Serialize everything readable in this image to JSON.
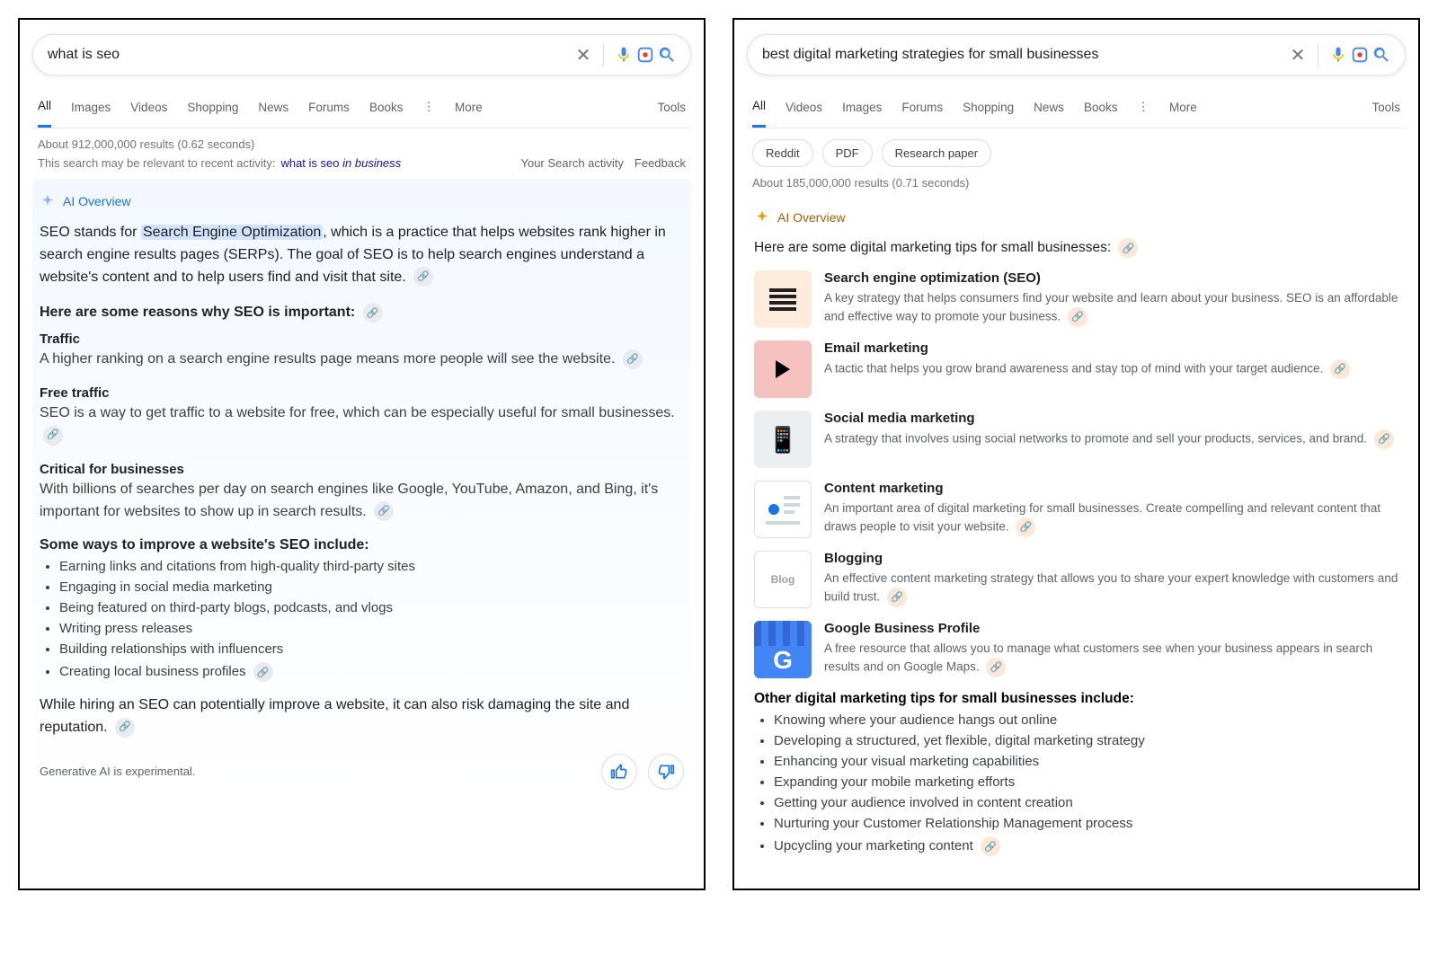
{
  "left": {
    "search": {
      "query": "what is seo"
    },
    "tabs": [
      "All",
      "Images",
      "Videos",
      "Shopping",
      "News",
      "Forums",
      "Books"
    ],
    "more": "More",
    "tools": "Tools",
    "results_meta": "About 912,000,000 results (0.62 seconds)",
    "activity": {
      "prefix": "This search may be relevant to recent activity:",
      "link_plain": "what is seo",
      "link_em": "in business",
      "search_activity": "Your Search activity",
      "feedback": "Feedback"
    },
    "ai_label": "AI Overview",
    "summary_pre": "SEO stands for ",
    "summary_hl": "Search Engine Optimization",
    "summary_post": ", which is a practice that helps websites rank higher in search engine results pages (SERPs). The goal of SEO is to help search engines understand a website's content and to help users find and visit that site.",
    "reasons_h": "Here are some reasons why SEO is important:",
    "reasons": [
      {
        "h": "Traffic",
        "p": "A higher ranking on a search engine results page means more people will see the website."
      },
      {
        "h": "Free traffic",
        "p": "SEO is a way to get traffic to a website for free, which can be especially useful for small businesses."
      },
      {
        "h": "Critical for businesses",
        "p": "With billions of searches per day on search engines like Google, YouTube, Amazon, and Bing, it's important for websites to show up in search results."
      }
    ],
    "ways_h": "Some ways to improve a website's SEO include:",
    "ways": [
      "Earning links and citations from high-quality third-party sites",
      "Engaging in social media marketing",
      "Being featured on third-party blogs, podcasts, and vlogs",
      "Writing press releases",
      "Building relationships with influencers",
      "Creating local business profiles"
    ],
    "closing": "While hiring an SEO can potentially improve a website, it can also risk damaging the site and reputation.",
    "experimental": "Generative AI is experimental."
  },
  "right": {
    "search": {
      "query": "best digital marketing strategies for small businesses"
    },
    "tabs": [
      "All",
      "Videos",
      "Images",
      "Forums",
      "Shopping",
      "News",
      "Books"
    ],
    "more": "More",
    "tools": "Tools",
    "chips": [
      "Reddit",
      "PDF",
      "Research paper"
    ],
    "results_meta": "About 185,000,000 results (0.71 seconds)",
    "ai_label": "AI Overview",
    "intro": "Here are some digital marketing tips for small businesses:",
    "tips": [
      {
        "title": "Search engine optimization (SEO)",
        "desc": "A key strategy that helps consumers find your website and learn about your business. SEO is an affordable and effective way to promote your business."
      },
      {
        "title": "Email marketing",
        "desc": "A tactic that helps you grow brand awareness and stay top of mind with your target audience."
      },
      {
        "title": "Social media marketing",
        "desc": "A strategy that involves using social networks to promote and sell your products, services, and brand."
      },
      {
        "title": "Content marketing",
        "desc": "An important area of digital marketing for small businesses. Create compelling and relevant content that draws people to visit your website."
      },
      {
        "title": "Blogging",
        "desc": "An effective content marketing strategy that allows you to share your expert knowledge with customers and build trust."
      },
      {
        "title": "Google Business Profile",
        "desc": "A free resource that allows you to manage what customers see when your business appears in search results and on Google Maps."
      }
    ],
    "other_h": "Other digital marketing tips for small businesses include:",
    "other": [
      "Knowing where your audience hangs out online",
      "Developing a structured, yet flexible, digital marketing strategy",
      "Enhancing your visual marketing capabilities",
      "Expanding your mobile marketing efforts",
      "Getting your audience involved in content creation",
      "Nurturing your Customer Relationship Management process",
      "Upcycling your marketing content"
    ]
  }
}
